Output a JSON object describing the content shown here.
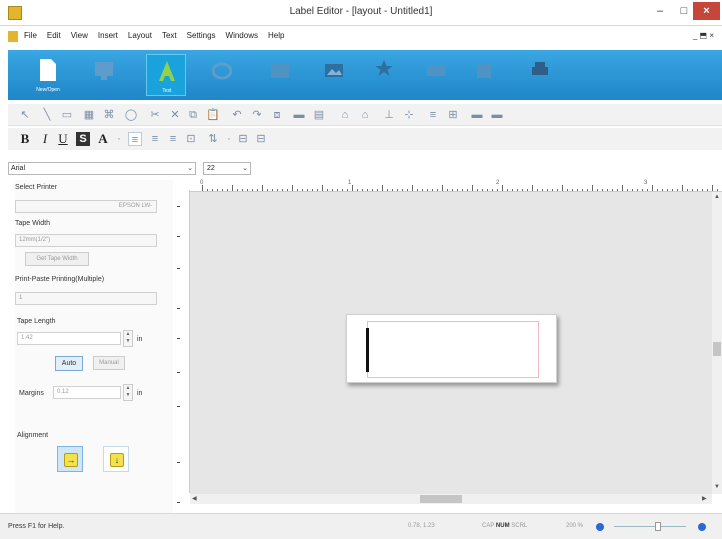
{
  "window": {
    "title": "Label Editor - [layout - Untitled1]",
    "minimize": "–",
    "maximize": "□",
    "close": "×"
  },
  "menu": {
    "items": [
      "File",
      "Edit",
      "View",
      "Insert",
      "Layout",
      "Text",
      "Settings",
      "Windows",
      "Help"
    ],
    "mdi_controls": "_ ⬒ ×"
  },
  "ribbon": {
    "buttons": [
      {
        "name": "new-open",
        "label": "New/Open",
        "icon": "document-icon",
        "active": false
      },
      {
        "name": "print-preview",
        "label": "",
        "icon": "monitor-icon",
        "active": false
      },
      {
        "name": "text",
        "label": "Text",
        "icon": "text-A-icon",
        "active": true
      },
      {
        "name": "frame",
        "label": "",
        "icon": "frame-icon",
        "active": false
      },
      {
        "name": "table",
        "label": "",
        "icon": "table-icon",
        "active": false
      },
      {
        "name": "image",
        "label": "",
        "icon": "image-icon",
        "active": false
      },
      {
        "name": "symbol",
        "label": "",
        "icon": "star-icon",
        "active": false
      },
      {
        "name": "barcode",
        "label": "",
        "icon": "barcode-icon",
        "active": false
      },
      {
        "name": "date",
        "label": "",
        "icon": "calendar-icon",
        "active": false
      },
      {
        "name": "print",
        "label": "",
        "icon": "printer-icon",
        "active": false
      }
    ]
  },
  "toolbar2": {
    "bold": "B",
    "italic": "I",
    "underline": "U",
    "shadow": "S",
    "font_color": "A"
  },
  "font": {
    "family": "Arial",
    "size": "22"
  },
  "printer_panel": {
    "select_printer_label": "Select Printer",
    "printer_value": "EPSON LW-",
    "tape_width_label": "Tape Width",
    "tape_width_value": "12mm(1/2\")",
    "get_tape_width": "Get Tape Width",
    "print_paste_label": "Print-Paste Printing(Multiple)",
    "print_paste_value": "1",
    "tape_length_label": "Tape Length",
    "tape_length_value": "1.42",
    "tape_length_unit": "in",
    "auto": "Auto",
    "manual": "Manual",
    "margins_label": "Margins",
    "margins_value": "0.12",
    "margins_unit": "in",
    "alignment_label": "Alignment"
  },
  "ruler": {
    "marks": [
      "0",
      "1",
      "2",
      "3"
    ]
  },
  "status": {
    "help": "Press F1 for Help.",
    "coords": "0.78, 1.23",
    "cap": "CAP",
    "num": "NUM",
    "scrl": "SCRL",
    "zoom": "200 %"
  }
}
